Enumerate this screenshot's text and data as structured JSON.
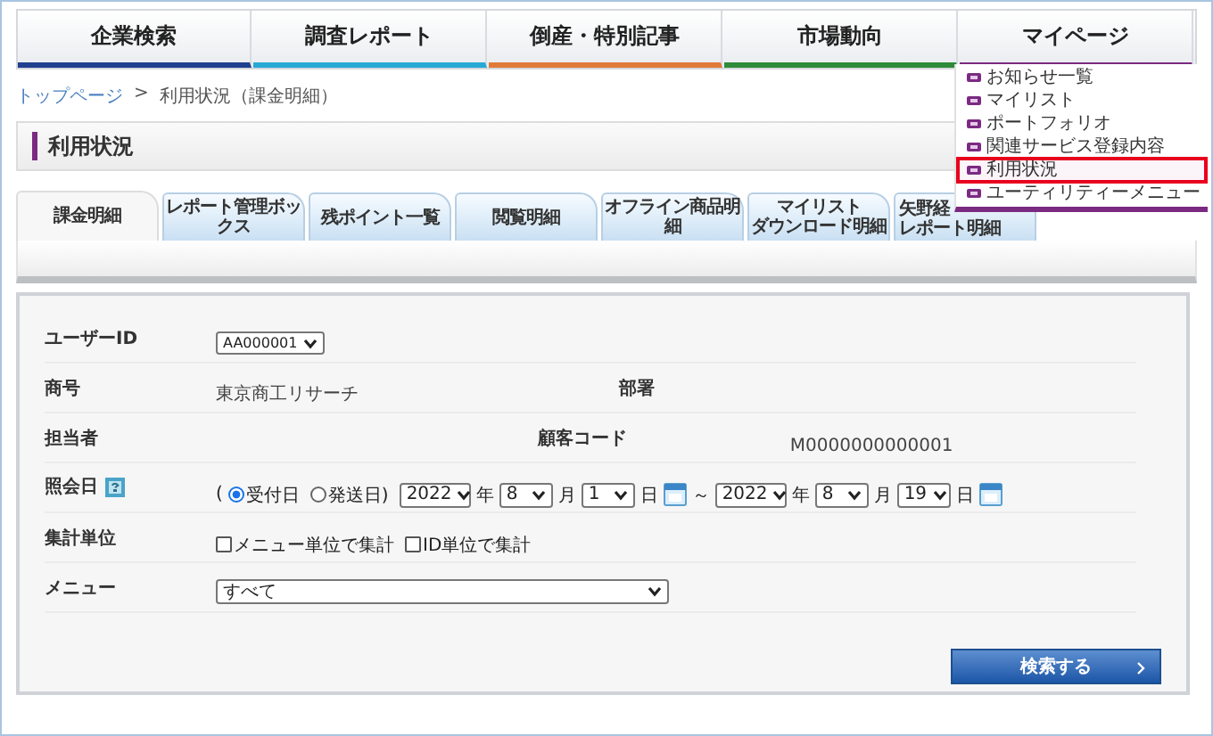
{
  "nav": [
    {
      "label": "企業検索",
      "color": "#1f3f8f"
    },
    {
      "label": "調査レポート",
      "color": "#27a9d6"
    },
    {
      "label": "倒産・特別記事",
      "color": "#e07a3a"
    },
    {
      "label": "市場動向",
      "color": "#2e8b3a"
    },
    {
      "label": "マイページ",
      "color": "#7b2a82",
      "expanded": true
    }
  ],
  "mypage_menu": [
    {
      "label": "お知らせ一覧",
      "selected": false
    },
    {
      "label": "マイリスト",
      "selected": false
    },
    {
      "label": "ポートフォリオ",
      "selected": false
    },
    {
      "label": "関連サービス登録内容",
      "selected": false
    },
    {
      "label": "利用状況",
      "selected": true
    },
    {
      "label": "ユーティリティーメニュー",
      "selected": false
    }
  ],
  "breadcrumb": {
    "link": "トップページ",
    "separator": ">",
    "current": "利用状況（課金明細）"
  },
  "page_title": "利用状況",
  "tabs": [
    {
      "lines": [
        "課金明細"
      ],
      "selected": true
    },
    {
      "lines": [
        "レポート管理ボックス"
      ],
      "selected": false
    },
    {
      "lines": [
        "残ポイント一覧"
      ],
      "selected": false
    },
    {
      "lines": [
        "閲覧明細"
      ],
      "selected": false
    },
    {
      "lines": [
        "オフライン商品明細"
      ],
      "selected": false
    },
    {
      "lines": [
        "マイリスト",
        "ダウンロード明細"
      ],
      "selected": false
    },
    {
      "lines": [
        "矢野経",
        "レポート明細"
      ],
      "selected": false
    }
  ],
  "form": {
    "user_id": {
      "label": "ユーザーID",
      "value": "AA000001"
    },
    "company": {
      "label": "商号",
      "value": "東京商工リサーチ"
    },
    "department": {
      "label": "部署"
    },
    "person": {
      "label": "担当者"
    },
    "customer_code": {
      "label": "顧客コード",
      "value": "M0000000000001"
    },
    "date": {
      "label": "照会日",
      "parts": [
        {
          "kind": "text",
          "text": "("
        },
        {
          "kind": "radio",
          "label": "受付日",
          "selected": true
        },
        {
          "kind": "radio",
          "label": "発送日)",
          "selected": false
        },
        {
          "kind": "select",
          "value": "2022"
        },
        {
          "kind": "text",
          "text": "年"
        },
        {
          "kind": "select",
          "value": "8"
        },
        {
          "kind": "text",
          "text": "月"
        },
        {
          "kind": "select",
          "value": "1"
        },
        {
          "kind": "text",
          "text": "日"
        },
        {
          "kind": "calendar"
        },
        {
          "kind": "text",
          "text": "～"
        },
        {
          "kind": "select",
          "value": "2022"
        },
        {
          "kind": "text",
          "text": "年"
        },
        {
          "kind": "select",
          "value": "8"
        },
        {
          "kind": "text",
          "text": "月"
        },
        {
          "kind": "select",
          "value": "19"
        },
        {
          "kind": "text",
          "text": "日"
        },
        {
          "kind": "calendar"
        }
      ]
    },
    "aggregation": {
      "label": "集計単位",
      "options": [
        {
          "label": "メニュー単位で集計",
          "checked": false
        },
        {
          "label": "ID単位で集計",
          "checked": false
        }
      ]
    },
    "menu": {
      "label": "メニュー",
      "value": "すべて"
    }
  },
  "search_button": "検索する"
}
